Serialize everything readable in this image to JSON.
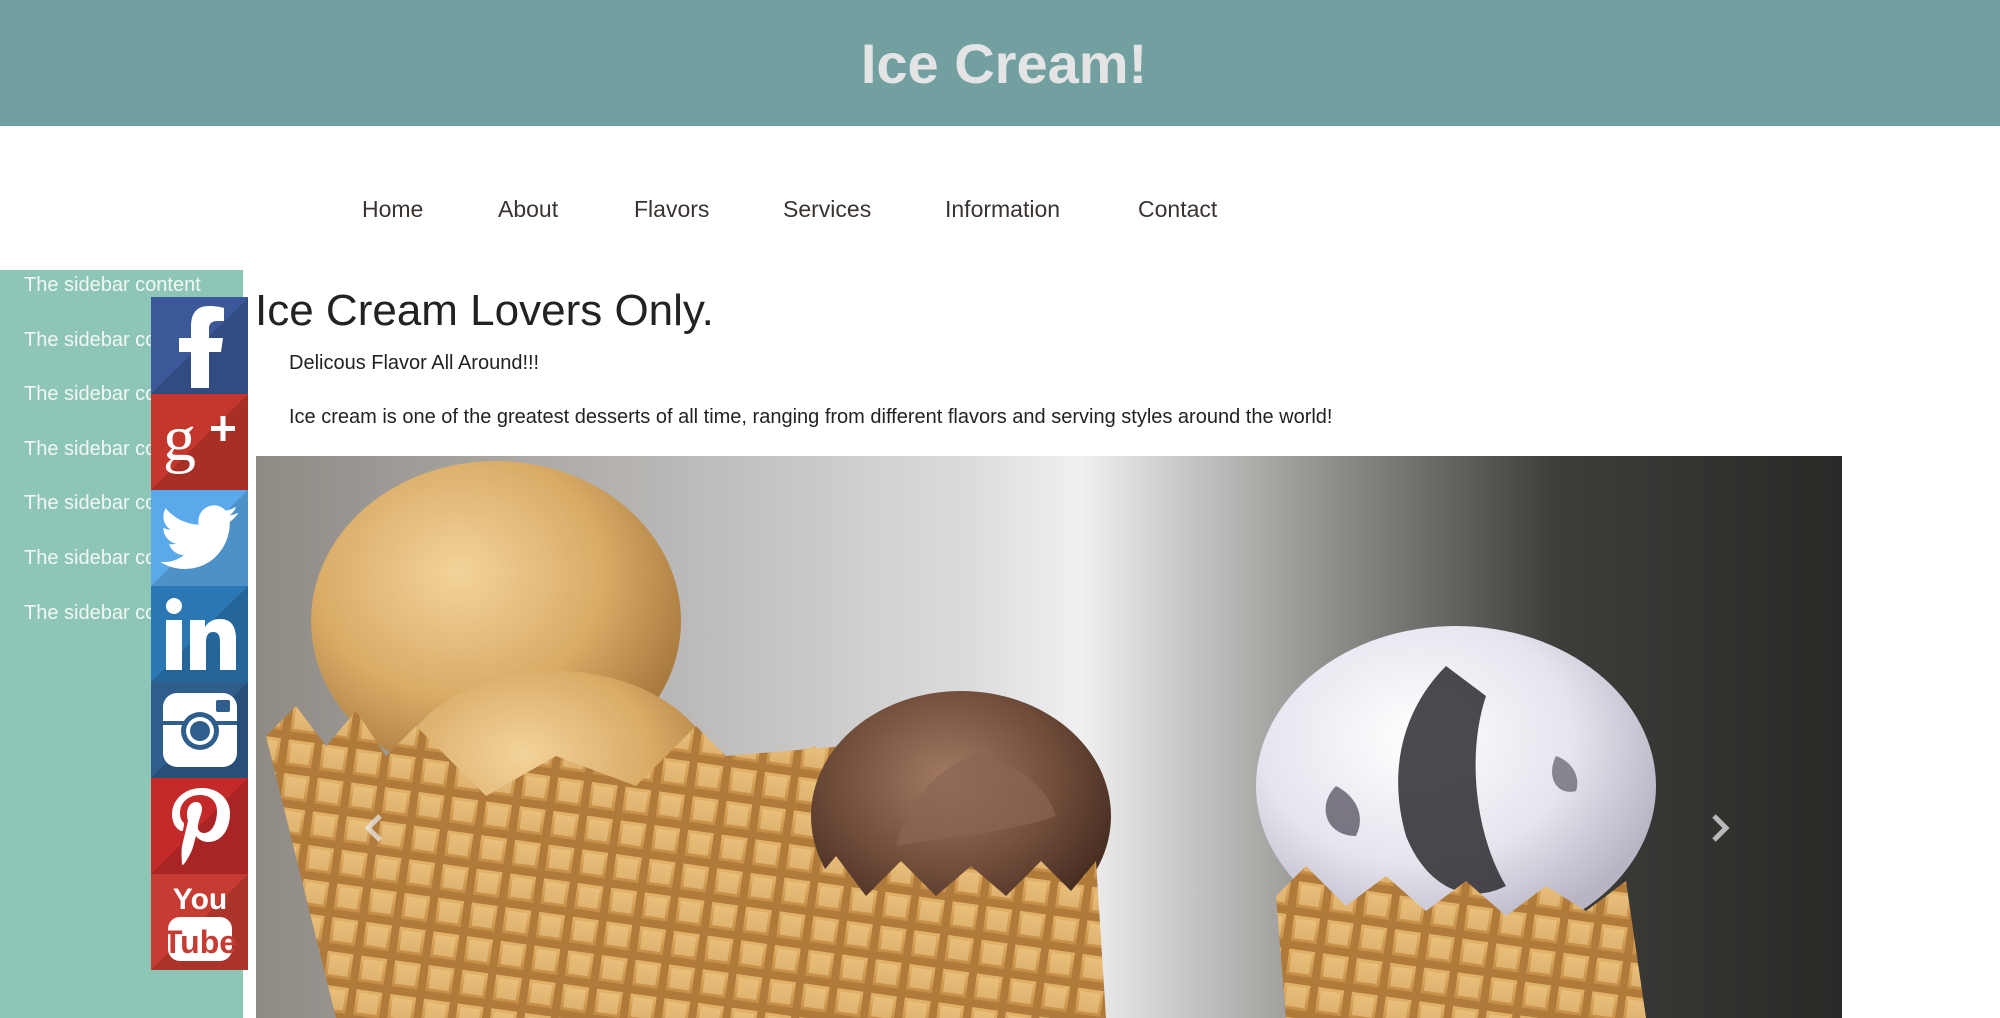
{
  "header": {
    "title": "Ice Cream!"
  },
  "nav": {
    "items": [
      {
        "label": "Home"
      },
      {
        "label": "About"
      },
      {
        "label": "Flavors"
      },
      {
        "label": "Services"
      },
      {
        "label": "Information"
      },
      {
        "label": "Contact"
      }
    ]
  },
  "sidebar": {
    "items": [
      {
        "label": "The sidebar content"
      },
      {
        "label": "The sidebar content"
      },
      {
        "label": "The sidebar content"
      },
      {
        "label": "The sidebar content"
      },
      {
        "label": "The sidebar content"
      },
      {
        "label": "The sidebar content"
      },
      {
        "label": "The sidebar content"
      }
    ]
  },
  "social": {
    "buttons": [
      {
        "icon": "facebook-icon",
        "color": "#3b5998"
      },
      {
        "icon": "google-plus-icon",
        "color": "#c4372c"
      },
      {
        "icon": "twitter-icon",
        "color": "#5aa9ea"
      },
      {
        "icon": "linkedin-icon",
        "color": "#2b77b3"
      },
      {
        "icon": "instagram-icon",
        "color": "#2f5d8c"
      },
      {
        "icon": "pinterest-icon",
        "color": "#c52a2a"
      },
      {
        "icon": "youtube-icon",
        "color": "#c63c32"
      }
    ],
    "youtube_label_top": "You",
    "youtube_label_bottom": "Tube"
  },
  "main": {
    "heading": "Ice Cream Lovers Only.",
    "tagline": "Delicous Flavor All Around!!!",
    "intro": "Ice cream is one of the greatest desserts of all time, ranging from different flavors and serving styles around the world!"
  },
  "carousel": {
    "prev_icon": "chevron-left-icon",
    "next_icon": "chevron-right-icon"
  },
  "colors": {
    "header_bg": "#72a0a1",
    "sidebar_bg": "#8dc6b6",
    "title_text": "#e4e4e4"
  }
}
